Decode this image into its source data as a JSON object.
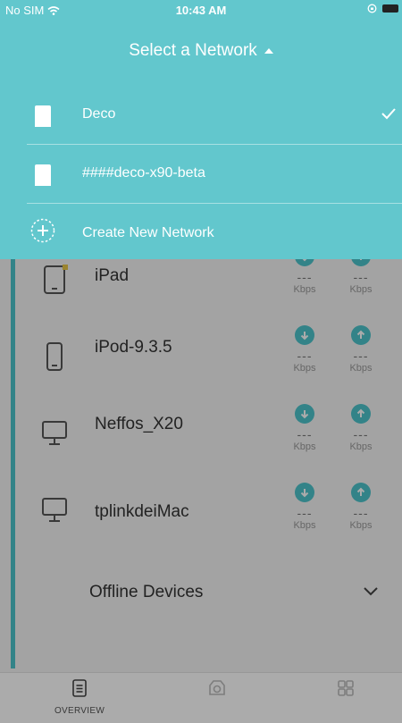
{
  "status_bar": {
    "carrier": "No SIM",
    "time": "10:43 AM"
  },
  "network_menu": {
    "title": "Select a Network",
    "networks": [
      {
        "name": "Deco",
        "selected": true
      },
      {
        "name": "####deco-x90-beta",
        "selected": false
      }
    ],
    "create_label": "Create New Network"
  },
  "devices": [
    {
      "name": "iPad",
      "icon": "tablet-icon",
      "download": "---",
      "download_unit": "Kbps",
      "upload": "---",
      "upload_unit": "Kbps"
    },
    {
      "name": "iPod-9.3.5",
      "icon": "mobile-icon",
      "download": "---",
      "download_unit": "Kbps",
      "upload": "---",
      "upload_unit": "Kbps"
    },
    {
      "name": "Neffos_X20",
      "icon": "desktop-icon",
      "download": "---",
      "download_unit": "Kbps",
      "upload": "---",
      "upload_unit": "Kbps"
    },
    {
      "name": "tplinkdeiMac",
      "icon": "desktop-icon",
      "download": "---",
      "download_unit": "Kbps",
      "upload": "---",
      "upload_unit": "Kbps"
    }
  ],
  "offline": {
    "label": "Offline Devices"
  },
  "tabs": [
    {
      "label": "OVERVIEW",
      "icon": "overview-icon"
    },
    {
      "label": "",
      "icon": "camera-icon"
    },
    {
      "label": "",
      "icon": "grid-icon"
    }
  ],
  "colors": {
    "accent": "#62c7cd",
    "accent_dim": "#4cc4cb"
  }
}
